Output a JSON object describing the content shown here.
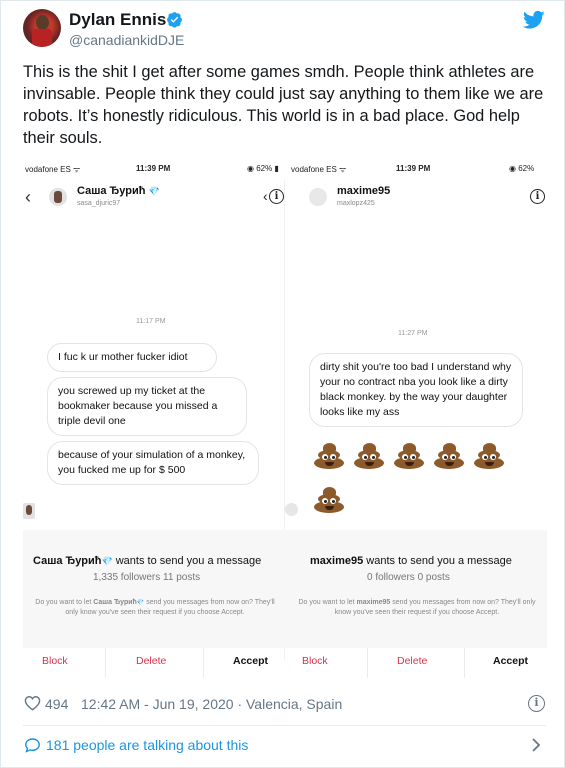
{
  "tweet": {
    "display_name": "Dylan Ennis",
    "handle": "@canadiankidDJE",
    "text": "This is the shit I get after some games smdh. People think athletes are invinsable. People think they could just say anything to them like we are robots. It’s honestly ridiculous. This world is in a bad place. God help their souls.",
    "likes": "494",
    "timestamp": "12:42 AM - Jun 19, 2020 · Valencia, Spain",
    "talking": "181 people are talking about this"
  },
  "colors": {
    "twitter_blue": "#1da1f2",
    "link_blue": "#1b95e0",
    "muted": "#657786",
    "block_red": "#d6334e"
  },
  "embed": {
    "left": {
      "carrier": "vodafone ES",
      "time": "11:39 PM",
      "battery": "62%",
      "chat_name": "Саша Ђурић",
      "chat_username": "sasa_djuric97",
      "msg_time": "11:17 PM",
      "messages": [
        "I fuc k ur mother fucker idiot",
        "you screwed up my ticket at the bookmaker because you missed a triple devil one",
        "because of your simulation of a monkey, you fucked me up for $ 500"
      ],
      "request_name": "Саша Ђурић",
      "request_suffix": "wants to send you a message",
      "request_stats": "1,335 followers 11 posts",
      "request_desc_1": "Do you want to let",
      "request_desc_name": "Саша Ђурић",
      "request_desc_2": "send you messages from now on? They'll only know you've seen their request if you choose Accept.",
      "block": "Block",
      "delete": "Delete",
      "accept": "Accept"
    },
    "right": {
      "carrier": "vodafone ES",
      "time": "11:39 PM",
      "battery": "62%",
      "chat_name": "maxime95",
      "chat_username": "maxlopz425",
      "msg_time": "11:27 PM",
      "message": "dirty shit you're too bad I understand why your no contract nba you look like a dirty black monkey. by the way your daughter looks like my ass",
      "request_name": "maxime95",
      "request_suffix": "wants to send you a message",
      "request_stats": "0 followers 0 posts",
      "request_desc_1": "Do you want to let",
      "request_desc_name": "maxime95",
      "request_desc_2": "send you messages from now on? They'll only know you've seen their request if you choose Accept.",
      "block": "Block",
      "delete": "Delete",
      "accept": "Accept"
    }
  }
}
